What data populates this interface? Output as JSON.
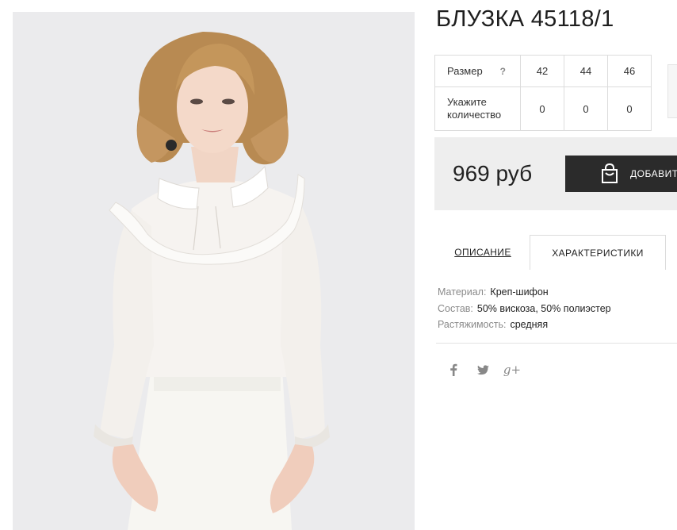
{
  "product": {
    "title": "БЛУЗКА 45118/1"
  },
  "sizes": {
    "size_label": "Размер",
    "help_glyph": "?",
    "quantity_label": "Укажите количество",
    "options": [
      "42",
      "44",
      "46"
    ],
    "quantities": [
      "0",
      "0",
      "0"
    ]
  },
  "purchase": {
    "price": "969 руб",
    "add_button_label": "ДОБАВИТЬ"
  },
  "tabs": {
    "description": "ОПИСАНИЕ",
    "characteristics": "ХАРАКТЕРИСТИКИ"
  },
  "characteristics": [
    {
      "label": "Материал:",
      "value": "Креп-шифон"
    },
    {
      "label": "Состав:",
      "value": "50% вискоза, 50% полиэстер"
    },
    {
      "label": "Растяжимость:",
      "value": "средняя"
    }
  ],
  "social": {
    "icons": [
      "facebook-icon",
      "twitter-icon",
      "google-plus-icon"
    ],
    "google_plus_glyph": "g+"
  },
  "colors": {
    "button_bg": "#2b2b2b",
    "price_bar_bg": "#eeeeee",
    "photo_bg": "#ebebed"
  }
}
